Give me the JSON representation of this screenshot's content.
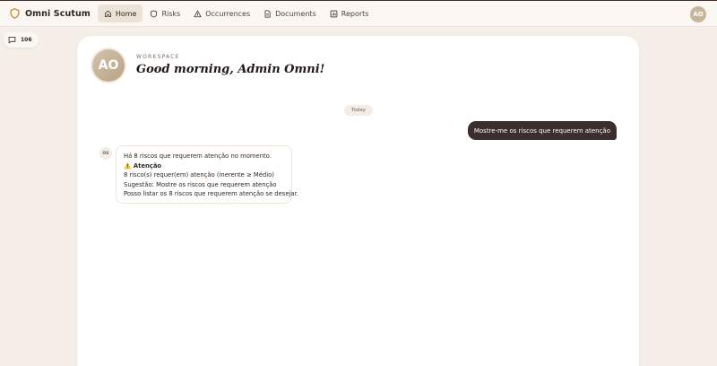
{
  "app": {
    "name": "Omni Scutum",
    "brand_icon": "shield-icon",
    "accent_color": "#3a2f2c"
  },
  "nav": {
    "items": [
      {
        "label": "Home",
        "icon": "home-icon",
        "active": true
      },
      {
        "label": "Risks",
        "icon": "shield-icon",
        "active": false
      },
      {
        "label": "Occurrences",
        "icon": "warning-icon",
        "active": false
      },
      {
        "label": "Documents",
        "icon": "document-icon",
        "active": false
      },
      {
        "label": "Reports",
        "icon": "chart-icon",
        "active": false
      }
    ]
  },
  "user": {
    "initials": "AO"
  },
  "sidebar": {
    "chat_count": "106",
    "chat_icon": "chat-icon"
  },
  "workspace": {
    "label": "WORKSPACE",
    "greeting": "Good morning, Admin Omni!"
  },
  "conversation": {
    "date_label": "Today",
    "user_message": "Mostre-me os riscos que requerem atenção",
    "bot_initials": "OS",
    "bot_lines": [
      "Há 8 riscos que requerem atenção no momento.",
      "⚠️ Atenção",
      "8 risco(s) requer(em) atenção (inerente ≥ Médio)",
      "Sugestão: Mostre os riscos que requerem atenção",
      "Posso listar os 8 riscos que requerem atenção se desejar."
    ]
  }
}
